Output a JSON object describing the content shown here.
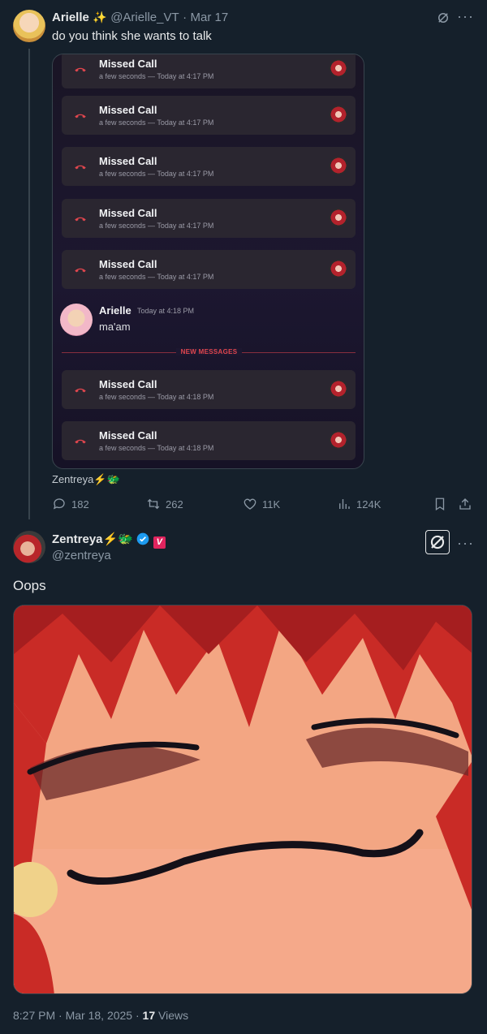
{
  "tweet1": {
    "name": "Arielle",
    "name_emoji": "✨",
    "handle": "@Arielle_VT",
    "separator": "·",
    "date": "Mar 17",
    "text": "do you think she wants to talk",
    "via_label": "Zentreya⚡🐲",
    "actions": {
      "replies": "182",
      "reposts": "262",
      "likes": "11K",
      "views": "124K"
    }
  },
  "embed": {
    "calls_before": [
      {
        "title": "Missed Call",
        "sub": "a few seconds — Today at 4:17 PM"
      },
      {
        "title": "Missed Call",
        "sub": "a few seconds — Today at 4:17 PM"
      },
      {
        "title": "Missed Call",
        "sub": "a few seconds — Today at 4:17 PM"
      },
      {
        "title": "Missed Call",
        "sub": "a few seconds — Today at 4:17 PM"
      },
      {
        "title": "Missed Call",
        "sub": "a few seconds — Today at 4:17 PM"
      }
    ],
    "message": {
      "author": "Arielle",
      "time": "Today at 4:18 PM",
      "text": "ma'am"
    },
    "new_messages_label": "NEW MESSAGES",
    "calls_after": [
      {
        "title": "Missed Call",
        "sub": "a few seconds — Today at 4:18 PM"
      },
      {
        "title": "Missed Call",
        "sub": "a few seconds — Today at 4:18 PM"
      }
    ]
  },
  "tweet2": {
    "name": "Zentreya⚡🐲",
    "handle": "@zentreya",
    "text": "Oops",
    "time": "8:27 PM",
    "separator": "·",
    "date": "Mar 18, 2025",
    "views_count": "17",
    "views_label": "Views"
  },
  "icons": [
    "grok-icon",
    "more-icon",
    "reply-icon",
    "repost-icon",
    "like-icon",
    "views-icon",
    "bookmark-icon",
    "share-icon",
    "verified-badge-icon",
    "phone-hangup-icon"
  ],
  "colors": {
    "background": "#15202b",
    "text": "#e7e9ea",
    "muted": "#8b98a5",
    "missed_call_red": "#e1464e",
    "verified_blue": "#1d9bf0",
    "affiliate_pink": "#e0245e"
  }
}
